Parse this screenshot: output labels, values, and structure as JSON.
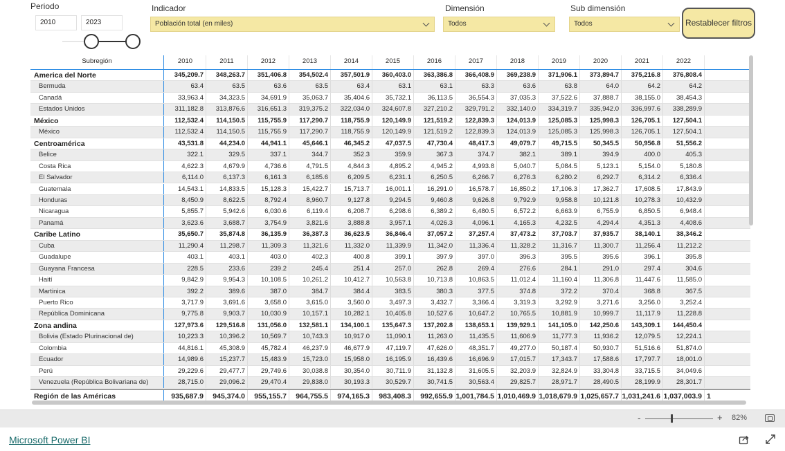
{
  "slicers": {
    "periodo": {
      "label": "Periodo",
      "from": "2010",
      "to": "2023"
    },
    "indicador": {
      "label": "Indicador",
      "value": "Población total (en miles)"
    },
    "dimension": {
      "label": "Dimensión",
      "value": "Todos"
    },
    "subdimension": {
      "label": "Sub dimensión",
      "value": "Todos"
    },
    "reset_label": "Restablecer filtros"
  },
  "table": {
    "header_label": "Subregión",
    "years": [
      "2010",
      "2011",
      "2012",
      "2013",
      "2014",
      "2015",
      "2016",
      "2017",
      "2018",
      "2019",
      "2020",
      "2021",
      "2022"
    ],
    "rows": [
      {
        "name": "America del Norte",
        "level": "group",
        "values": [
          "345,209.7",
          "348,263.7",
          "351,406.8",
          "354,502.4",
          "357,501.9",
          "360,403.0",
          "363,386.8",
          "366,408.9",
          "369,238.9",
          "371,906.1",
          "373,894.7",
          "375,216.8",
          "376,808.4"
        ]
      },
      {
        "name": "Bermuda",
        "level": "sub",
        "values": [
          "63.4",
          "63.5",
          "63.6",
          "63.5",
          "63.4",
          "63.1",
          "63.1",
          "63.3",
          "63.6",
          "63.8",
          "64.0",
          "64.2",
          "64.2"
        ]
      },
      {
        "name": "Canadá",
        "level": "sub",
        "values": [
          "33,963.4",
          "34,323.5",
          "34,691.9",
          "35,063.7",
          "35,404.6",
          "35,732.1",
          "36,113.5",
          "36,554.3",
          "37,035.3",
          "37,522.6",
          "37,888.7",
          "38,155.0",
          "38,454.3"
        ]
      },
      {
        "name": "Estados Unidos",
        "level": "sub",
        "values": [
          "311,182.8",
          "313,876.6",
          "316,651.3",
          "319,375.2",
          "322,034.0",
          "324,607.8",
          "327,210.2",
          "329,791.2",
          "332,140.0",
          "334,319.7",
          "335,942.0",
          "336,997.6",
          "338,289.9"
        ]
      },
      {
        "name": "México",
        "level": "group",
        "values": [
          "112,532.4",
          "114,150.5",
          "115,755.9",
          "117,290.7",
          "118,755.9",
          "120,149.9",
          "121,519.2",
          "122,839.3",
          "124,013.9",
          "125,085.3",
          "125,998.3",
          "126,705.1",
          "127,504.1"
        ]
      },
      {
        "name": "México",
        "level": "sub",
        "values": [
          "112,532.4",
          "114,150.5",
          "115,755.9",
          "117,290.7",
          "118,755.9",
          "120,149.9",
          "121,519.2",
          "122,839.3",
          "124,013.9",
          "125,085.3",
          "125,998.3",
          "126,705.1",
          "127,504.1"
        ]
      },
      {
        "name": "Centroamérica",
        "level": "group",
        "values": [
          "43,531.8",
          "44,234.0",
          "44,941.1",
          "45,646.1",
          "46,345.2",
          "47,037.5",
          "47,730.4",
          "48,417.3",
          "49,079.7",
          "49,715.5",
          "50,345.5",
          "50,956.8",
          "51,556.2"
        ]
      },
      {
        "name": "Belice",
        "level": "sub",
        "values": [
          "322.1",
          "329.5",
          "337.1",
          "344.7",
          "352.3",
          "359.9",
          "367.3",
          "374.7",
          "382.1",
          "389.1",
          "394.9",
          "400.0",
          "405.3"
        ]
      },
      {
        "name": "Costa Rica",
        "level": "sub",
        "values": [
          "4,622.3",
          "4,679.9",
          "4,736.6",
          "4,791.5",
          "4,844.3",
          "4,895.2",
          "4,945.2",
          "4,993.8",
          "5,040.7",
          "5,084.5",
          "5,123.1",
          "5,154.0",
          "5,180.8"
        ]
      },
      {
        "name": "El Salvador",
        "level": "sub",
        "values": [
          "6,114.0",
          "6,137.3",
          "6,161.3",
          "6,185.6",
          "6,209.5",
          "6,231.1",
          "6,250.5",
          "6,266.7",
          "6,276.3",
          "6,280.2",
          "6,292.7",
          "6,314.2",
          "6,336.4"
        ]
      },
      {
        "name": "Guatemala",
        "level": "sub",
        "values": [
          "14,543.1",
          "14,833.5",
          "15,128.3",
          "15,422.7",
          "15,713.7",
          "16,001.1",
          "16,291.0",
          "16,578.7",
          "16,850.2",
          "17,106.3",
          "17,362.7",
          "17,608.5",
          "17,843.9"
        ]
      },
      {
        "name": "Honduras",
        "level": "sub",
        "values": [
          "8,450.9",
          "8,622.5",
          "8,792.4",
          "8,960.7",
          "9,127.8",
          "9,294.5",
          "9,460.8",
          "9,626.8",
          "9,792.9",
          "9,958.8",
          "10,121.8",
          "10,278.3",
          "10,432.9"
        ]
      },
      {
        "name": "Nicaragua",
        "level": "sub",
        "values": [
          "5,855.7",
          "5,942.6",
          "6,030.6",
          "6,119.4",
          "6,208.7",
          "6,298.6",
          "6,389.2",
          "6,480.5",
          "6,572.2",
          "6,663.9",
          "6,755.9",
          "6,850.5",
          "6,948.4"
        ]
      },
      {
        "name": "Panamá",
        "level": "sub",
        "values": [
          "3,623.6",
          "3,688.7",
          "3,754.9",
          "3,821.6",
          "3,888.8",
          "3,957.1",
          "4,026.3",
          "4,096.1",
          "4,165.3",
          "4,232.5",
          "4,294.4",
          "4,351.3",
          "4,408.6"
        ]
      },
      {
        "name": "Caribe Latino",
        "level": "group",
        "values": [
          "35,650.7",
          "35,874.8",
          "36,135.9",
          "36,387.3",
          "36,623.5",
          "36,846.4",
          "37,057.2",
          "37,257.4",
          "37,473.2",
          "37,703.7",
          "37,935.7",
          "38,140.1",
          "38,346.2"
        ]
      },
      {
        "name": "Cuba",
        "level": "sub",
        "values": [
          "11,290.4",
          "11,298.7",
          "11,309.3",
          "11,321.6",
          "11,332.0",
          "11,339.9",
          "11,342.0",
          "11,336.4",
          "11,328.2",
          "11,316.7",
          "11,300.7",
          "11,256.4",
          "11,212.2"
        ]
      },
      {
        "name": "Guadalupe",
        "level": "sub",
        "values": [
          "403.1",
          "403.1",
          "403.0",
          "402.3",
          "400.8",
          "399.1",
          "397.9",
          "397.0",
          "396.3",
          "395.5",
          "395.6",
          "396.1",
          "395.8"
        ]
      },
      {
        "name": "Guayana Francesa",
        "level": "sub",
        "values": [
          "228.5",
          "233.6",
          "239.2",
          "245.4",
          "251.4",
          "257.0",
          "262.8",
          "269.4",
          "276.6",
          "284.1",
          "291.0",
          "297.4",
          "304.6"
        ]
      },
      {
        "name": "Haití",
        "level": "sub",
        "values": [
          "9,842.9",
          "9,954.3",
          "10,108.5",
          "10,261.2",
          "10,412.7",
          "10,563.8",
          "10,713.8",
          "10,863.5",
          "11,012.4",
          "11,160.4",
          "11,306.8",
          "11,447.6",
          "11,585.0"
        ]
      },
      {
        "name": "Martinica",
        "level": "sub",
        "values": [
          "392.2",
          "389.6",
          "387.0",
          "384.7",
          "384.4",
          "383.5",
          "380.3",
          "377.5",
          "374.8",
          "372.2",
          "370.4",
          "368.8",
          "367.5"
        ]
      },
      {
        "name": "Puerto Rico",
        "level": "sub",
        "values": [
          "3,717.9",
          "3,691.6",
          "3,658.0",
          "3,615.0",
          "3,560.0",
          "3,497.3",
          "3,432.7",
          "3,366.4",
          "3,319.3",
          "3,292.9",
          "3,271.6",
          "3,256.0",
          "3,252.4"
        ]
      },
      {
        "name": "República Dominicana",
        "level": "sub",
        "values": [
          "9,775.8",
          "9,903.7",
          "10,030.9",
          "10,157.1",
          "10,282.1",
          "10,405.8",
          "10,527.6",
          "10,647.2",
          "10,765.5",
          "10,881.9",
          "10,999.7",
          "11,117.9",
          "11,228.8"
        ]
      },
      {
        "name": "Zona andina",
        "level": "group",
        "values": [
          "127,973.6",
          "129,516.8",
          "131,056.0",
          "132,581.1",
          "134,100.1",
          "135,647.3",
          "137,202.8",
          "138,653.1",
          "139,929.1",
          "141,105.0",
          "142,250.6",
          "143,309.1",
          "144,450.4"
        ]
      },
      {
        "name": "Bolivia (Estado Plurinacional de)",
        "level": "sub",
        "values": [
          "10,223.3",
          "10,396.2",
          "10,569.7",
          "10,743.3",
          "10,917.0",
          "11,090.1",
          "11,263.0",
          "11,435.5",
          "11,606.9",
          "11,777.3",
          "11,936.2",
          "12,079.5",
          "12,224.1"
        ]
      },
      {
        "name": "Colombia",
        "level": "sub",
        "values": [
          "44,816.1",
          "45,308.9",
          "45,782.4",
          "46,237.9",
          "46,677.9",
          "47,119.7",
          "47,626.0",
          "48,351.7",
          "49,277.0",
          "50,187.4",
          "50,930.7",
          "51,516.6",
          "51,874.0"
        ]
      },
      {
        "name": "Ecuador",
        "level": "sub",
        "values": [
          "14,989.6",
          "15,237.7",
          "15,483.9",
          "15,723.0",
          "15,958.0",
          "16,195.9",
          "16,439.6",
          "16,696.9",
          "17,015.7",
          "17,343.7",
          "17,588.6",
          "17,797.7",
          "18,001.0"
        ]
      },
      {
        "name": "Perú",
        "level": "sub",
        "values": [
          "29,229.6",
          "29,477.7",
          "29,749.6",
          "30,038.8",
          "30,354.0",
          "30,711.9",
          "31,132.8",
          "31,605.5",
          "32,203.9",
          "32,824.9",
          "33,304.8",
          "33,715.5",
          "34,049.6"
        ]
      },
      {
        "name": "Venezuela (República Bolivariana de)",
        "level": "sub",
        "values": [
          "28,715.0",
          "29,096.2",
          "29,470.4",
          "29,838.0",
          "30,193.3",
          "30,529.7",
          "30,741.5",
          "30,563.4",
          "29,825.7",
          "28,971.7",
          "28,490.5",
          "28,199.9",
          "28,301.7"
        ]
      }
    ],
    "total": {
      "name": "Región de las Américas",
      "values": [
        "935,687.9",
        "945,374.0",
        "955,155.7",
        "964,755.5",
        "974,165.3",
        "983,408.3",
        "992,655.9",
        "1,001,784.5",
        "1,010,469.9",
        "1,018,679.9",
        "1,025,657.7",
        "1,031,241.6",
        "1,037,003.9"
      ],
      "overflow": "1"
    }
  },
  "footer": {
    "zoom_minus": "-",
    "zoom_plus": "+",
    "zoom_pct": "82%",
    "powerbi_link": "Microsoft Power BI"
  },
  "colors": {
    "accent_yellow": "#f5e8a4",
    "header_line": "#2f8de4",
    "link": "#1a6b6b"
  }
}
